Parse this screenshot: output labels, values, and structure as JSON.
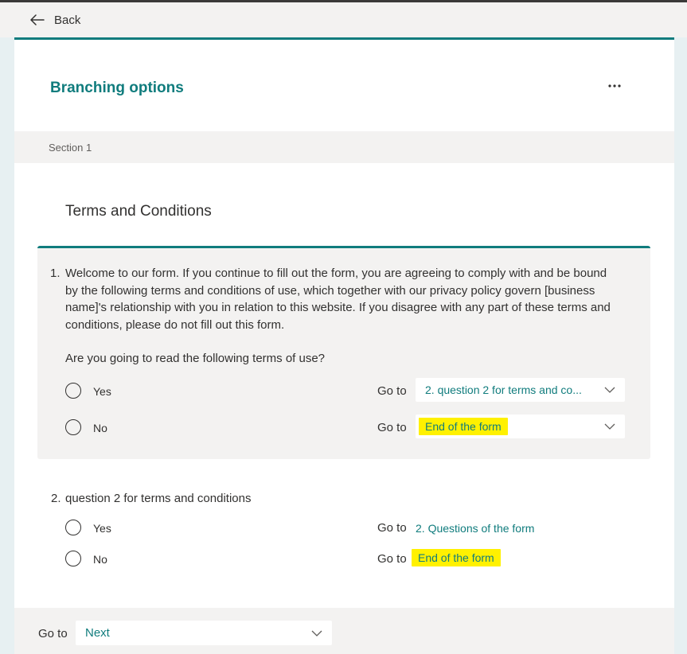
{
  "topbar": {
    "back_label": "Back"
  },
  "header": {
    "title": "Branching options"
  },
  "section": {
    "label": "Section 1",
    "title": "Terms and Conditions"
  },
  "q1": {
    "number": "1.",
    "text": "Welcome to our form. If you continue to fill out the form, you are agreeing to comply with and be bound by the following terms and conditions of use, which together with our privacy policy govern [business name]'s relationship with you in relation to this website. If you disagree with any part of these terms and conditions, please do not fill out this form.",
    "prompt": "Are you going to read the following terms of use?",
    "options": [
      {
        "label": "Yes",
        "goto_label": "Go to",
        "goto_value": "2. question 2 for terms and co..."
      },
      {
        "label": "No",
        "goto_label": "Go to",
        "goto_value": "End of the form"
      }
    ]
  },
  "q2": {
    "number": "2.",
    "text": "question 2 for terms and conditions",
    "options": [
      {
        "label": "Yes",
        "goto_label": "Go to",
        "goto_value": "2. Questions of the form"
      },
      {
        "label": "No",
        "goto_label": "Go to",
        "goto_value": "End of the form"
      }
    ]
  },
  "footer": {
    "goto_label": "Go to",
    "goto_value": "Next"
  },
  "colors": {
    "accent": "#107c7d",
    "highlight": "#fff100",
    "panel_bg": "#f3f2f1"
  },
  "icons": [
    "back-arrow-icon",
    "more-icon",
    "chevron-down-icon"
  ]
}
